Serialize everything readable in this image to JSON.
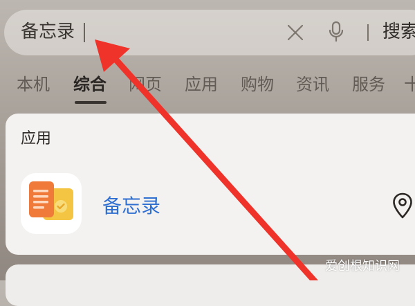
{
  "search": {
    "query": "备忘录",
    "button_label": "搜索"
  },
  "tabs": [
    {
      "label": "本机"
    },
    {
      "label": "综合",
      "active": true
    },
    {
      "label": "网页"
    },
    {
      "label": "应用"
    },
    {
      "label": "购物"
    },
    {
      "label": "资讯"
    },
    {
      "label": "服务"
    },
    {
      "label": "十"
    }
  ],
  "results": {
    "section_label": "应用",
    "app": {
      "name": "备忘录",
      "icon": "memo-app-icon"
    }
  },
  "icons": {
    "clear": "close-icon",
    "voice": "microphone-icon",
    "location": "location-pin-icon"
  },
  "colors": {
    "accent_link": "#2f6fd1",
    "annotation_arrow": "#f0332a"
  },
  "watermark": "爱创根知识网"
}
